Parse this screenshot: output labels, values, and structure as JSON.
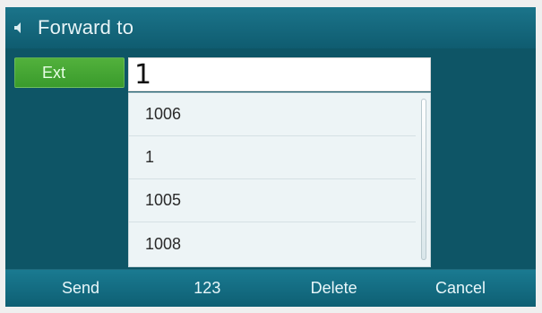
{
  "window": {
    "title": "Forward to"
  },
  "field": {
    "label": "Ext",
    "value": "1"
  },
  "dropdown": {
    "items": [
      "1006",
      "1",
      "1005",
      "1008"
    ]
  },
  "softkeys": {
    "send": "Send",
    "input_mode": "123",
    "delete": "Delete",
    "cancel": "Cancel"
  },
  "colors": {
    "background": "#0f5566",
    "titlebar": "#1b748a",
    "label_green": "#3a9b2c",
    "dropdown_bg": "#edf4f6"
  },
  "icons": {
    "back": "speaker-back-icon"
  }
}
